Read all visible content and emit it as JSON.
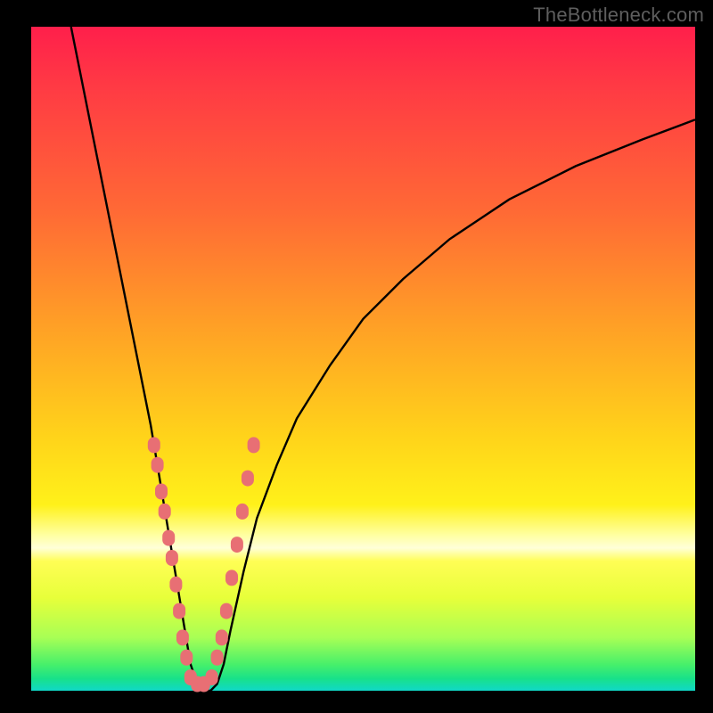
{
  "watermark": "TheBottleneck.com",
  "chart_data": {
    "type": "line",
    "title": "",
    "xlabel": "",
    "ylabel": "",
    "xlim": [
      0,
      100
    ],
    "ylim": [
      0,
      100
    ],
    "series": [
      {
        "name": "bottleneck-curve",
        "x": [
          6,
          8,
          10,
          12,
          14,
          16,
          18,
          19,
          20,
          21,
          22,
          23,
          24,
          25,
          26,
          27,
          28,
          29,
          30,
          32,
          34,
          37,
          40,
          45,
          50,
          56,
          63,
          72,
          82,
          92,
          100
        ],
        "y": [
          100,
          90,
          80,
          70,
          60,
          50,
          40,
          34,
          28,
          22,
          16,
          10,
          4,
          1,
          0,
          0,
          1,
          4,
          9,
          18,
          26,
          34,
          41,
          49,
          56,
          62,
          68,
          74,
          79,
          83,
          86
        ]
      }
    ],
    "markers": {
      "name": "highlight-points",
      "x": [
        18.5,
        19.0,
        19.6,
        20.1,
        20.7,
        21.2,
        21.8,
        22.3,
        22.8,
        23.4,
        24.0,
        25.0,
        26.0,
        27.2,
        28.0,
        28.7,
        29.4,
        30.2,
        31.0,
        31.8,
        32.6,
        33.5
      ],
      "y": [
        37,
        34,
        30,
        27,
        23,
        20,
        16,
        12,
        8,
        5,
        2,
        1,
        1,
        2,
        5,
        8,
        12,
        17,
        22,
        27,
        32,
        37
      ]
    },
    "gradient_bands": [
      "#ff1f4b",
      "#ff6a35",
      "#ffd41a",
      "#ffffa0",
      "#18e18a"
    ]
  }
}
